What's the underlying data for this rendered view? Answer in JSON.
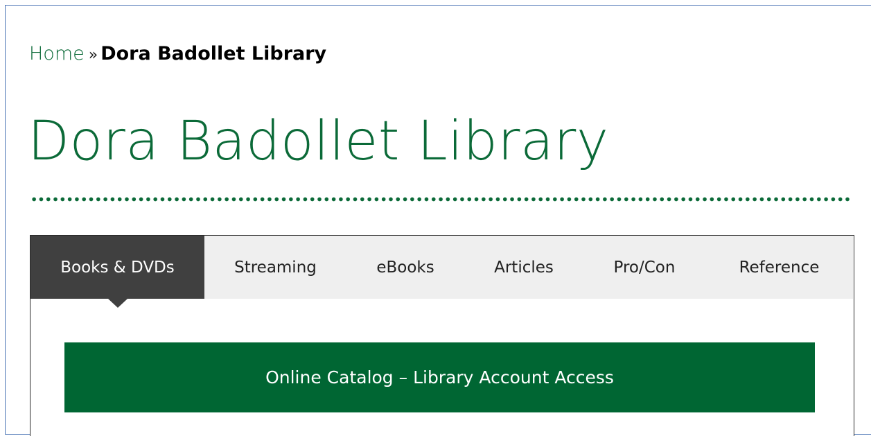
{
  "breadcrumb": {
    "home": "Home",
    "separator": "»",
    "current": "Dora Badollet Library"
  },
  "page": {
    "title": "Dora Badollet Library"
  },
  "tabs": [
    {
      "label": "Books & DVDs",
      "active": true
    },
    {
      "label": "Streaming",
      "active": false
    },
    {
      "label": "eBooks",
      "active": false
    },
    {
      "label": "Articles",
      "active": false
    },
    {
      "label": "Pro/Con",
      "active": false
    },
    {
      "label": "Reference",
      "active": false
    }
  ],
  "panel": {
    "catalog_button_label": "Online Catalog – Library Account Access"
  },
  "colors": {
    "brand_green": "#006633",
    "title_green": "#0b6a38",
    "active_tab": "#404040",
    "tab_bar": "#efefef"
  }
}
